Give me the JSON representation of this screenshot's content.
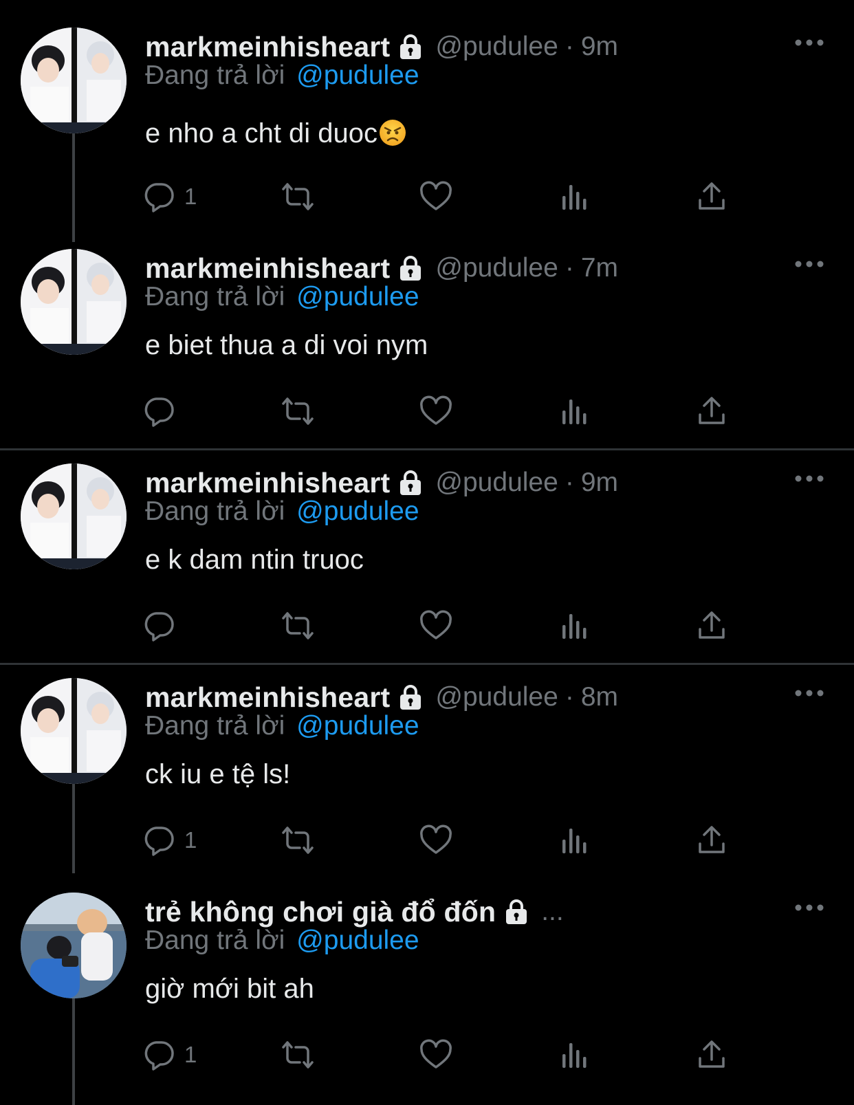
{
  "colors": {
    "background": "#000000",
    "text_primary": "#e7e9ea",
    "text_secondary": "#71767b",
    "accent": "#1d9bf0",
    "divider": "#2f3336"
  },
  "tweets": [
    {
      "display_name": "markmeinhisheart",
      "protected_icon": "lock-icon",
      "handle": "@pudulee",
      "separator": "·",
      "time": "9m",
      "reply_prefix": "Đang trả lời",
      "reply_to": "@pudulee",
      "text": "e nho a cht di duoc",
      "emoji": "angry-face-emoji",
      "reply_count": "1",
      "avatar": "avatar-photo"
    },
    {
      "display_name": "markmeinhisheart",
      "protected_icon": "lock-icon",
      "handle": "@pudulee",
      "separator": "·",
      "time": "7m",
      "reply_prefix": "Đang trả lời",
      "reply_to": "@pudulee",
      "text": "e biet thua a di voi nym",
      "reply_count": "",
      "avatar": "avatar-photo"
    },
    {
      "display_name": "markmeinhisheart",
      "protected_icon": "lock-icon",
      "handle": "@pudulee",
      "separator": "·",
      "time": "9m",
      "reply_prefix": "Đang trả lời",
      "reply_to": "@pudulee",
      "text": "e k dam ntin truoc",
      "reply_count": "",
      "avatar": "avatar-photo"
    },
    {
      "display_name": "markmeinhisheart",
      "protected_icon": "lock-icon",
      "handle": "@pudulee",
      "separator": "·",
      "time": "8m",
      "reply_prefix": "Đang trả lời",
      "reply_to": "@pudulee",
      "text": "ck iu e tệ ls!",
      "reply_count": "1",
      "avatar": "avatar-photo"
    },
    {
      "display_name": "trẻ không chơi già đổ đốn",
      "protected_icon": "lock-icon",
      "truncation": "...",
      "reply_prefix": "Đang trả lời",
      "reply_to": "@pudulee",
      "text": "giờ mới bit ah",
      "reply_count": "1",
      "avatar": "avatar-photo-outdoor"
    }
  ],
  "action_icons": [
    "reply-icon",
    "retweet-icon",
    "like-icon",
    "views-icon",
    "share-icon"
  ],
  "menu_icon": "more-icon"
}
